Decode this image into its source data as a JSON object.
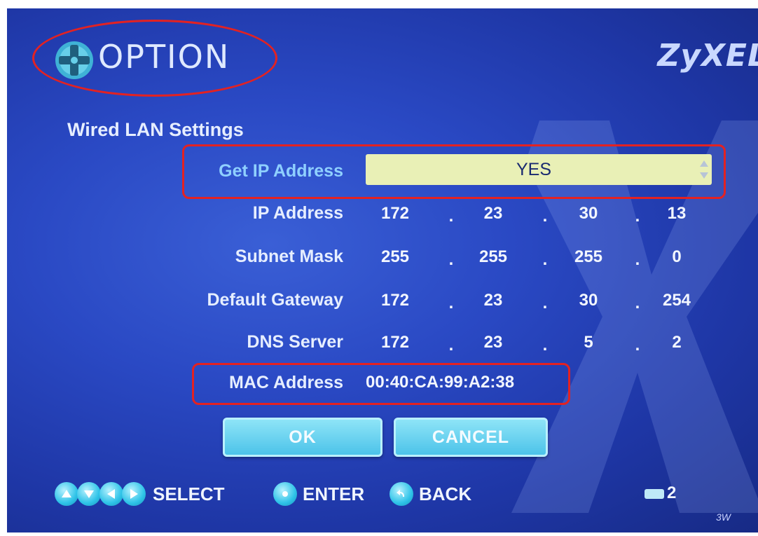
{
  "header": {
    "title": "OPTION",
    "brand": "ZyXEL"
  },
  "section_title": "Wired LAN Settings",
  "fields": {
    "get_ip": {
      "label": "Get IP Address",
      "value": "YES"
    },
    "ip_address": {
      "label": "IP Address",
      "octets": [
        "172",
        "23",
        "30",
        "13"
      ]
    },
    "subnet_mask": {
      "label": "Subnet Mask",
      "octets": [
        "255",
        "255",
        "255",
        "0"
      ]
    },
    "default_gateway": {
      "label": "Default Gateway",
      "octets": [
        "172",
        "23",
        "30",
        "254"
      ]
    },
    "dns_server": {
      "label": "DNS Server",
      "octets": [
        "172",
        "23",
        "5",
        "2"
      ]
    },
    "mac_address": {
      "label": "MAC Address",
      "value": "00:40:CA:99:A2:38"
    }
  },
  "separator": ".",
  "buttons": {
    "ok": "OK",
    "cancel": "CANCEL"
  },
  "footer": {
    "select": "SELECT",
    "enter": "ENTER",
    "back": "BACK",
    "page": "2"
  },
  "corner_mark": "3W",
  "colors": {
    "background": "#2a49c4",
    "highlight_outline": "#e32222",
    "field_fill": "#e9f0b6",
    "button": "#4cc3e9",
    "label_highlight": "#8fd0ff"
  },
  "icons": [
    "dpad-icon",
    "up-arrow-icon",
    "down-arrow-icon",
    "left-arrow-icon",
    "right-arrow-icon",
    "enter-icon",
    "back-icon",
    "page-indicator-icon"
  ]
}
